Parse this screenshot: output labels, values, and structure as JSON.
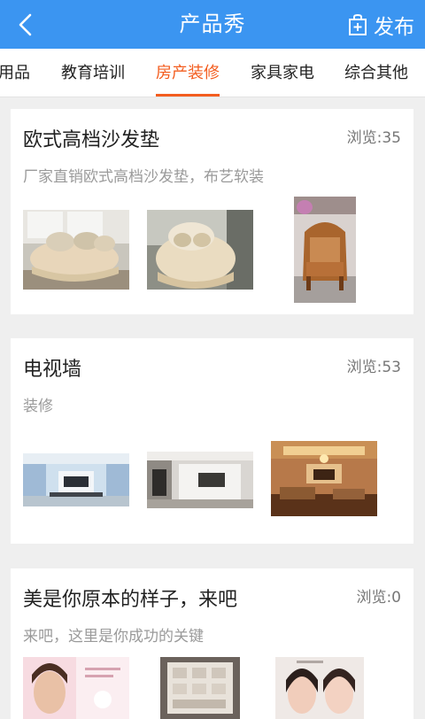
{
  "header": {
    "title": "产品秀",
    "publish_label": "发布",
    "back_icon": "chevron-left-icon",
    "publish_icon": "add-bag-icon"
  },
  "tabs": [
    {
      "label": "用品"
    },
    {
      "label": "教育培训"
    },
    {
      "label": "房产装修",
      "active": true
    },
    {
      "label": "家具家电"
    },
    {
      "label": "综合其他"
    }
  ],
  "posts": [
    {
      "title": "欧式高档沙发垫",
      "views": "浏览:35",
      "desc": "厂家直销欧式高档沙发垫，布艺软装",
      "images": [
        "sofa-cushion-photo",
        "armchair-cover-photo",
        "carved-chair-photo"
      ]
    },
    {
      "title": "电视墙",
      "views": "浏览:53",
      "desc": "装修",
      "images": [
        "tv-wall-blue-photo",
        "tv-wall-white-photo",
        "living-room-warm-photo"
      ]
    },
    {
      "title": "美是你原本的样子，来吧",
      "views": "浏览:0",
      "desc": "来吧，这里是你成功的关键",
      "images": [
        "beauty-poster-photo",
        "product-box-photo",
        "women-portrait-photo"
      ]
    }
  ],
  "colors": {
    "header_bg": "#3b95f1",
    "active_tab": "#f35d1f",
    "page_bg": "#efefef"
  }
}
